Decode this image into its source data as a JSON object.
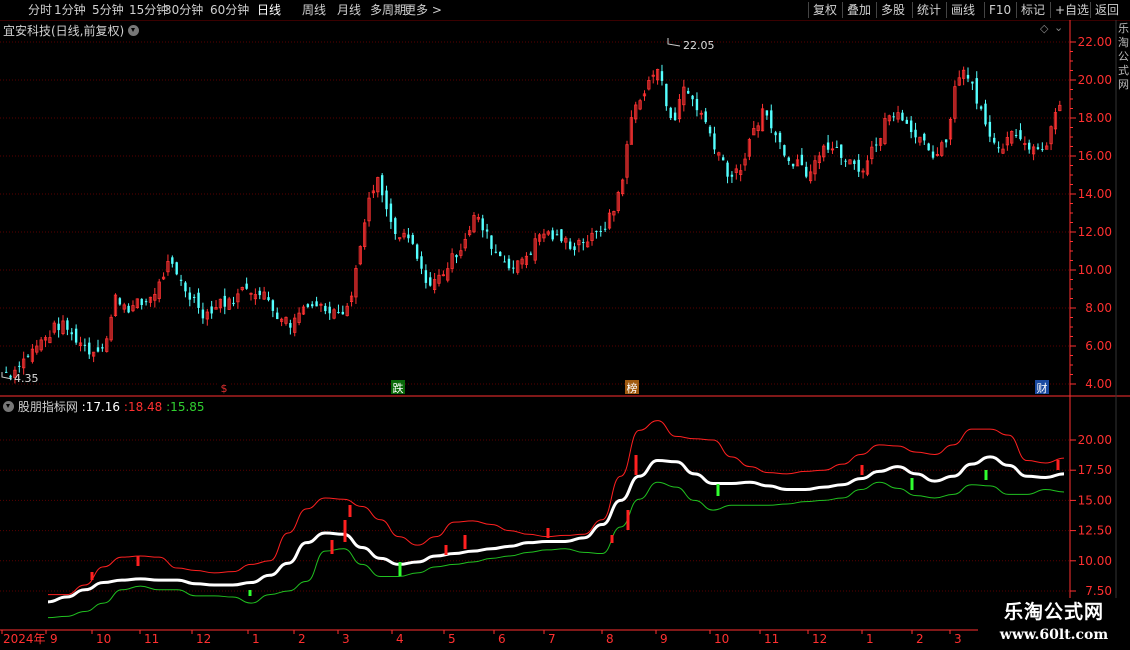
{
  "toolbar": {
    "periods": [
      {
        "label": "分时",
        "active": false
      },
      {
        "label": "1分钟",
        "active": false
      },
      {
        "label": "5分钟",
        "active": false
      },
      {
        "label": "15分钟",
        "active": false
      },
      {
        "label": "30分钟",
        "active": false
      },
      {
        "label": "60分钟",
        "active": false
      },
      {
        "label": "日线",
        "active": true
      },
      {
        "label": "周线",
        "active": false
      },
      {
        "label": "月线",
        "active": false
      },
      {
        "label": "多周期",
        "active": false
      },
      {
        "label": "更多 >",
        "active": false
      }
    ],
    "buttons": [
      "复权",
      "叠加",
      "多股",
      "统计",
      "画线",
      "F10",
      "标记",
      "+自选",
      "返回"
    ]
  },
  "main_panel": {
    "title": "宜安科技(日线,前复权)",
    "high_label": "22.05",
    "low_label": "4.35",
    "yticks": [
      "22.00",
      "20.00",
      "18.00",
      "16.00",
      "14.00",
      "12.00",
      "10.00",
      "8.00",
      "6.00",
      "4.00"
    ],
    "markers": [
      {
        "text": "$",
        "color": "#e03030",
        "bg": "#000000"
      },
      {
        "text": "跌",
        "color": "#ffffff",
        "bg": "#0a6a0a"
      },
      {
        "text": "榜",
        "color": "#ffffff",
        "bg": "#a05a10"
      },
      {
        "text": "财",
        "color": "#ffffff",
        "bg": "#1a4aa0"
      }
    ]
  },
  "indicator_panel": {
    "name": "股朋指标网",
    "values": [
      {
        "text": ":17.16",
        "color": "#ffffff"
      },
      {
        "text": ":18.48",
        "color": "#ff3030"
      },
      {
        "text": ":15.85",
        "color": "#30d030"
      }
    ],
    "yticks": [
      "20.00",
      "17.50",
      "15.00",
      "12.50",
      "10.00",
      "7.50"
    ]
  },
  "time_axis": {
    "labels": [
      "2024年",
      "9",
      "10",
      "11",
      "12",
      "1",
      "2",
      "3",
      "4",
      "5",
      "6",
      "7",
      "8",
      "9",
      "10",
      "11",
      "12",
      "1",
      "2",
      "3"
    ]
  },
  "side_text": "乐淘公式网",
  "watermark": {
    "line1": "乐淘公式网",
    "line2": "www.60lt.com"
  },
  "colors": {
    "up": "#ff3232",
    "down": "#54ffff",
    "mid": "#ffffff",
    "upper": "#ff2020",
    "lower": "#20c020",
    "grid": "#5a0000",
    "axis": "#ff3030"
  },
  "chart_data": {
    "type": "line",
    "title": "宜安科技(日线,前复权)",
    "series": [
      {
        "name": "price",
        "values": [
          4.6,
          5.2,
          5.6,
          6.0,
          6.4,
          6.9,
          7.0,
          6.5,
          6.2,
          5.8,
          6.0,
          6.4,
          8.5,
          8.2,
          8.0,
          8.2,
          8.6,
          9.2,
          10.2,
          9.6,
          9.0,
          8.4,
          7.8,
          8.0,
          8.4,
          8.2,
          8.6,
          9.2,
          9.0,
          8.6,
          8.0,
          7.6,
          7.2,
          7.8,
          8.4,
          8.2,
          8.0,
          8.2,
          8.0,
          8.6,
          11.5,
          13.5,
          14.6,
          13.0,
          11.8,
          11.6,
          11.2,
          9.8,
          9.2,
          9.6,
          10.2,
          11.0,
          11.8,
          12.8,
          12.2,
          11.4,
          10.8,
          10.4,
          10.2,
          10.8,
          11.4,
          12.0,
          11.8,
          11.6,
          11.4,
          11.5,
          11.6,
          11.8,
          12.4,
          13.2,
          15.0,
          18.0,
          19.2,
          19.8,
          20.6,
          18.8,
          18.0,
          19.6,
          19.0,
          18.2,
          17.2,
          16.2,
          15.2,
          15.0,
          15.6,
          17.4,
          18.4,
          17.6,
          16.6,
          16.0,
          15.8,
          15.2,
          16.0,
          16.8,
          16.4,
          16.0,
          15.6,
          15.2,
          15.8,
          16.8,
          17.8,
          18.4,
          18.2,
          17.6,
          16.8,
          16.0,
          15.8,
          16.8,
          19.6,
          20.8,
          19.8,
          18.4,
          17.2,
          16.2,
          16.8,
          17.4,
          17.0,
          16.4,
          16.6,
          17.4,
          18.4
        ]
      },
      {
        "name": "中轨",
        "values": [
          6.6,
          7.0,
          7.6,
          8.2,
          8.4,
          8.5,
          8.4,
          8.4,
          8.1,
          8.0,
          8.0,
          8.2,
          8.8,
          9.8,
          11.5,
          12.3,
          12.2,
          11.1,
          10.2,
          9.7,
          9.9,
          10.4,
          10.6,
          10.8,
          11.0,
          11.2,
          11.5,
          11.6,
          11.6,
          11.9,
          13.0,
          15.0,
          17.0,
          18.3,
          18.2,
          17.2,
          16.4,
          16.4,
          16.5,
          16.2,
          15.9,
          15.9,
          16.1,
          16.3,
          16.8,
          17.4,
          17.8,
          17.2,
          16.6,
          17.0,
          18.0,
          18.6,
          17.9,
          17.0,
          16.9,
          17.2
        ]
      },
      {
        "name": "上轨",
        "values": [
          7.2,
          7.2,
          8.0,
          9.5,
          10.3,
          10.4,
          10.3,
          9.4,
          9.2,
          9.0,
          9.1,
          9.7,
          10.0,
          12.3,
          14.3,
          15.2,
          15.1,
          14.5,
          13.4,
          12.0,
          11.3,
          12.0,
          13.2,
          13.3,
          13.0,
          12.5,
          12.2,
          12.0,
          12.1,
          12.2,
          13.4,
          17.0,
          20.8,
          21.6,
          20.3,
          20.1,
          20.0,
          18.6,
          17.8,
          17.3,
          17.2,
          17.4,
          17.5,
          18.0,
          18.8,
          19.6,
          19.5,
          19.0,
          18.8,
          19.6,
          20.9,
          20.9,
          20.4,
          18.3,
          18.1,
          18.5
        ]
      },
      {
        "name": "下轨",
        "values": [
          5.3,
          5.4,
          5.8,
          6.5,
          7.6,
          7.9,
          7.6,
          7.6,
          7.1,
          7.1,
          7.0,
          6.5,
          7.2,
          7.5,
          8.3,
          10.8,
          11.0,
          9.7,
          8.7,
          8.7,
          9.0,
          9.5,
          9.7,
          9.9,
          10.2,
          10.4,
          10.7,
          10.9,
          11.0,
          10.7,
          10.6,
          12.8,
          15.1,
          16.5,
          16.1,
          15.0,
          14.2,
          14.6,
          14.6,
          14.6,
          14.7,
          14.9,
          15.0,
          15.2,
          15.9,
          16.5,
          16.0,
          15.4,
          15.2,
          15.5,
          16.3,
          16.2,
          15.5,
          15.5,
          15.9,
          15.7
        ]
      }
    ],
    "ylim": [
      3.6,
      23.0
    ],
    "indicator_ylim": [
      6.0,
      23.0
    ]
  }
}
